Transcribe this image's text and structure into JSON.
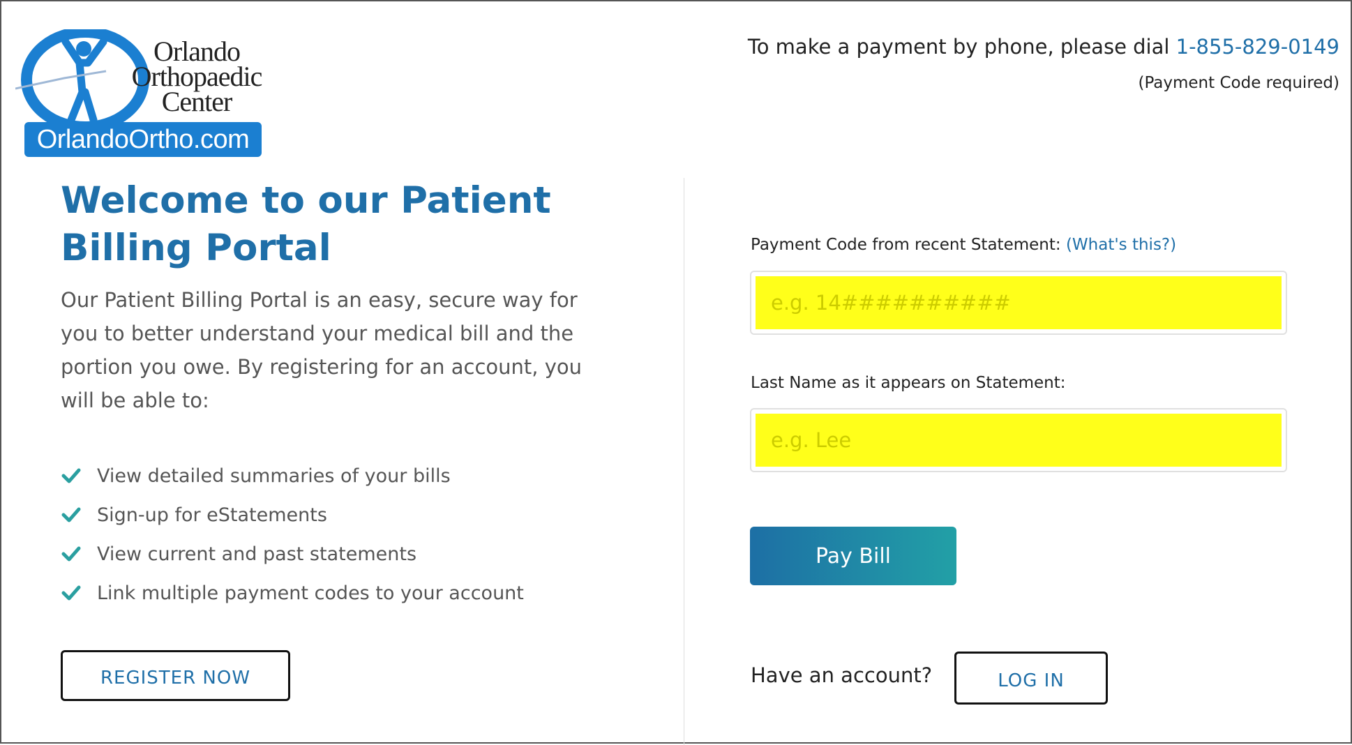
{
  "logo": {
    "text_line1": "Orlando",
    "text_line2": "Orthopaedic",
    "text_line3": "Center",
    "site": "OrlandoOrtho.com"
  },
  "header": {
    "phone_prefix": "To make a payment by phone, please dial ",
    "phone_number": "1-855-829-0149",
    "phone_note": "(Payment Code required)"
  },
  "left": {
    "title": "Welcome to our Patient Billing Portal",
    "intro": "Our Patient Billing Portal is an easy, secure way for you to better understand your medical bill and the portion you owe. By registering for an account, you will be able to:",
    "benefits": [
      "View detailed summaries of your bills",
      "Sign-up for eStatements",
      "View current and past statements",
      "Link multiple payment codes to your account"
    ],
    "register_label": "REGISTER NOW"
  },
  "form": {
    "code_label": "Payment Code from recent Statement: ",
    "code_help": "(What's this?)",
    "code_placeholder": "e.g. 14##########",
    "code_value": "",
    "name_label": "Last Name as it appears on Statement:",
    "name_placeholder": "e.g. Lee",
    "name_value": "",
    "pay_label": "Pay Bill",
    "have_account": "Have an account?",
    "login_label": "LOG IN"
  },
  "colors": {
    "accent": "#1f6fa8",
    "highlight": "#ffff1a",
    "check": "#2a9fa0"
  },
  "icons": {
    "check": "check-icon",
    "logo": "running-figure-logo-icon"
  }
}
